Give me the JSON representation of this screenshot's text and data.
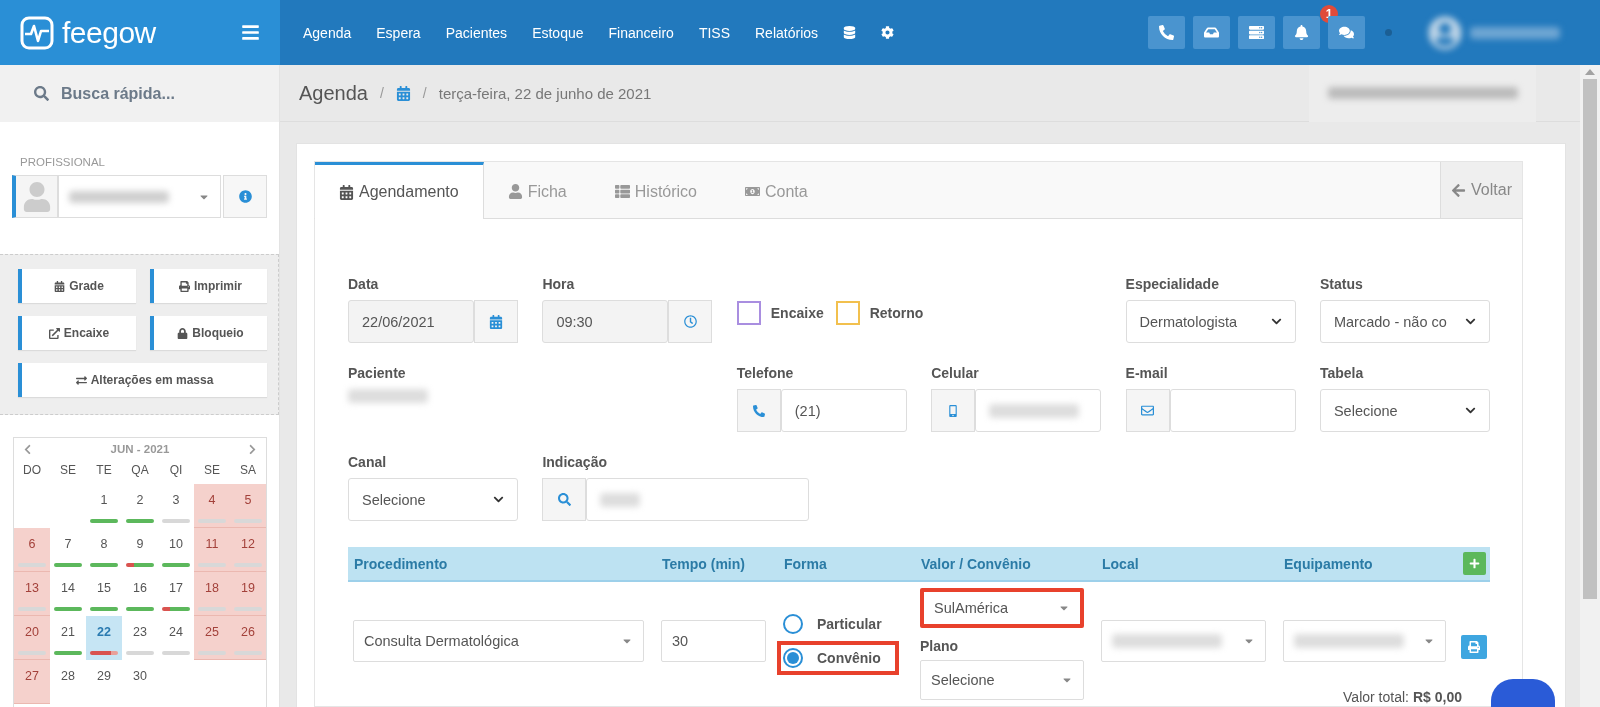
{
  "topbar": {
    "logo": "feegow",
    "nav": [
      "Agenda",
      "Espera",
      "Pacientes",
      "Estoque",
      "Financeiro",
      "TISS",
      "Relatórios"
    ],
    "nav_icons": [
      {
        "kind": "database"
      },
      {
        "kind": "cog"
      }
    ],
    "buttons": [
      {
        "kind": "phone"
      },
      {
        "kind": "inbox"
      },
      {
        "kind": "server"
      },
      {
        "kind": "bell",
        "badge": "1"
      },
      {
        "kind": "comments"
      }
    ]
  },
  "sidebar": {
    "search_placeholder": "Busca rápida...",
    "professional_label": "PROFISSIONAL",
    "actions": [
      {
        "label": "Grade",
        "kind": "calendar"
      },
      {
        "label": "Imprimir",
        "kind": "print"
      },
      {
        "label": "Encaixe",
        "kind": "external"
      },
      {
        "label": "Bloqueio",
        "kind": "lock"
      },
      {
        "label": "Alterações em massa",
        "kind": "exchange"
      }
    ],
    "calendar": {
      "month": "JUN - 2021",
      "weekdays": [
        "DO",
        "SE",
        "TE",
        "QA",
        "QI",
        "SE",
        "SA"
      ],
      "weeks": [
        [
          {
            "day": "1",
            "weekend": false,
            "selected": false,
            "kind": "free"
          },
          {
            "day": "2",
            "weekend": false,
            "selected": false,
            "kind": "free"
          },
          {
            "day": "3",
            "weekend": false,
            "selected": false,
            "kind": "none"
          },
          {
            "day": "4",
            "weekend": true,
            "selected": false,
            "kind": "none"
          },
          {
            "day": "5",
            "weekend": true,
            "selected": false,
            "kind": "none"
          }
        ],
        [
          {
            "day": "6",
            "weekend": true,
            "selected": false,
            "kind": "none"
          },
          {
            "day": "7",
            "weekend": false,
            "selected": false,
            "kind": "free"
          },
          {
            "day": "8",
            "weekend": false,
            "selected": false,
            "kind": "free"
          },
          {
            "day": "9",
            "weekend": false,
            "selected": false,
            "kind": "mixed"
          },
          {
            "day": "10",
            "weekend": false,
            "selected": false,
            "kind": "free"
          },
          {
            "day": "11",
            "weekend": true,
            "selected": false,
            "kind": "none"
          },
          {
            "day": "12",
            "weekend": true,
            "selected": false,
            "kind": "none"
          }
        ],
        [
          {
            "day": "13",
            "weekend": true,
            "selected": false,
            "kind": "none"
          },
          {
            "day": "14",
            "weekend": false,
            "selected": false,
            "kind": "free"
          },
          {
            "day": "15",
            "weekend": false,
            "selected": false,
            "kind": "free"
          },
          {
            "day": "16",
            "weekend": false,
            "selected": false,
            "kind": "free"
          },
          {
            "day": "17",
            "weekend": false,
            "selected": false,
            "kind": "mixed"
          },
          {
            "day": "18",
            "weekend": true,
            "selected": false,
            "kind": "none"
          },
          {
            "day": "19",
            "weekend": true,
            "selected": false,
            "kind": "none"
          }
        ],
        [
          {
            "day": "20",
            "weekend": true,
            "selected": false,
            "kind": "none"
          },
          {
            "day": "21",
            "weekend": false,
            "selected": false,
            "kind": "free"
          },
          {
            "day": "22",
            "weekend": false,
            "selected": true,
            "kind": "busy"
          },
          {
            "day": "23",
            "weekend": false,
            "selected": false,
            "kind": "none"
          },
          {
            "day": "24",
            "weekend": false,
            "selected": false,
            "kind": "none"
          },
          {
            "day": "25",
            "weekend": true,
            "selected": false,
            "kind": "none"
          },
          {
            "day": "26",
            "weekend": true,
            "selected": false,
            "kind": "none"
          }
        ],
        [
          {
            "day": "27",
            "weekend": true,
            "selected": false
          },
          {
            "day": "28",
            "weekend": false,
            "selected": false
          },
          {
            "day": "29",
            "weekend": false,
            "selected": false
          },
          {
            "day": "30",
            "weekend": false,
            "selected": false
          }
        ]
      ]
    }
  },
  "breadcrumb": {
    "title": "Agenda",
    "separators": [
      "/",
      "/"
    ],
    "date": "terça-feira, 22 de junho de 2021"
  },
  "tabs": [
    {
      "label": "Agendamento",
      "kind": "calendar",
      "selected": true
    },
    {
      "label": "Ficha",
      "kind": "user",
      "selected": false
    },
    {
      "label": "Histórico",
      "kind": "list",
      "selected": false
    },
    {
      "label": "Conta",
      "kind": "money",
      "selected": false
    }
  ],
  "back_button": "Voltar",
  "form": {
    "data": {
      "label": "Data",
      "value": "22/06/2021"
    },
    "hora": {
      "label": "Hora",
      "value": "09:30"
    },
    "checkboxes": [
      {
        "label": "Encaixe",
        "checked": false,
        "color": "#a98ee0"
      },
      {
        "label": "Retorno",
        "checked": false,
        "color": "#f2c04e"
      }
    ],
    "especialidade": {
      "label": "Especialidade",
      "value": "Dermatologista"
    },
    "status": {
      "label": "Status",
      "value": "Marcado - não co"
    },
    "paciente": {
      "label": "Paciente"
    },
    "telefone": {
      "label": "Telefone",
      "value": "(21)"
    },
    "celular": {
      "label": "Celular"
    },
    "email": {
      "label": "E-mail"
    },
    "tabela": {
      "label": "Tabela",
      "value": "Selecione"
    },
    "canal": {
      "label": "Canal",
      "value": "Selecione"
    },
    "indicacao": {
      "label": "Indicação"
    }
  },
  "procedures": {
    "columns": [
      "Procedimento",
      "Tempo (min)",
      "Forma",
      "Valor / Convênio",
      "Local",
      "Equipamento"
    ],
    "rows": [
      {
        "procedimento": "Consulta Dermatológica",
        "tempo": "30",
        "forma": [
          {
            "label": "Particular",
            "selected": false,
            "highlighted": false
          },
          {
            "label": "Convênio",
            "selected": true,
            "highlighted": true
          }
        ],
        "convenio": {
          "value": "SulAmérica",
          "highlighted": true
        },
        "plano": {
          "label": "Plano",
          "value": "Selecione"
        }
      }
    ],
    "total": {
      "label": "Valor total:",
      "value": "R$ 0,00"
    }
  }
}
